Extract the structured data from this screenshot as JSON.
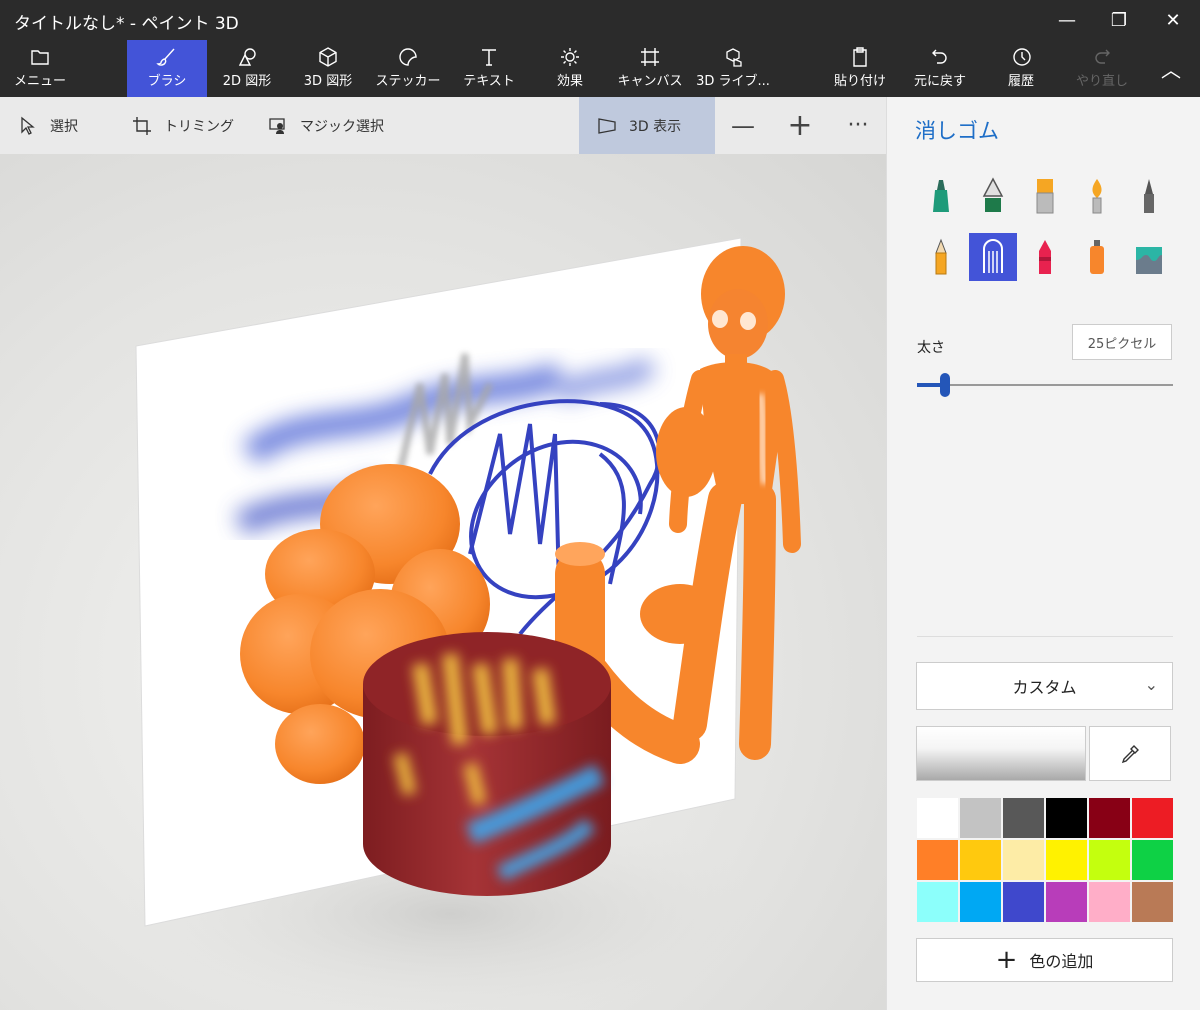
{
  "window": {
    "title": "タイトルなし* - ペイント 3D",
    "minimize_glyph": "—",
    "maximize_glyph": "❐",
    "close_glyph": "✕"
  },
  "ribbon": {
    "tabs": [
      {
        "label": "メニュー",
        "icon": "folder-icon"
      },
      {
        "label": "ブラシ",
        "icon": "brush-icon",
        "active": true
      },
      {
        "label": "2D 図形",
        "icon": "2d-shapes-icon"
      },
      {
        "label": "3D 図形",
        "icon": "3d-shapes-icon"
      },
      {
        "label": "ステッカー",
        "icon": "sticker-icon"
      },
      {
        "label": "テキスト",
        "icon": "text-icon"
      },
      {
        "label": "効果",
        "icon": "effects-icon"
      },
      {
        "label": "キャンバス",
        "icon": "canvas-icon"
      },
      {
        "label": "3D ライブ...",
        "icon": "3d-library-icon"
      },
      {
        "label": "貼り付け",
        "icon": "paste-icon"
      },
      {
        "label": "元に戻す",
        "icon": "undo-icon"
      },
      {
        "label": "履歴",
        "icon": "history-icon"
      },
      {
        "label": "やり直し",
        "icon": "redo-icon",
        "disabled": true
      }
    ],
    "collapse_glyph": "︿"
  },
  "toolbar": {
    "select": "選択",
    "crop": "トリミング",
    "magic_select": "マジック選択",
    "view3d": "3D 表示",
    "zoom_out": "—",
    "zoom_in": "+",
    "more": "···"
  },
  "panel": {
    "title": "消しゴム",
    "tools": [
      "marker-icon",
      "calligraphy-pen-icon",
      "oil-brush-icon",
      "watercolor-icon",
      "pixel-pen-icon",
      "pencil-icon",
      "eraser-icon",
      "crayon-icon",
      "spray-can-icon",
      "fill-icon"
    ],
    "selected_tool": "eraser-icon",
    "thickness_label": "太さ",
    "thickness_value": "25ピクセル",
    "thickness_fraction": 0.11,
    "color_mode": "カスタム",
    "palette": [
      "#ffffff",
      "#c3c3c3",
      "#585858",
      "#000000",
      "#880015",
      "#ed1c24",
      "#ff7f27",
      "#ffc90e",
      "#fdeca6",
      "#fff200",
      "#c4ff0e",
      "#0ed145",
      "#8cfffb",
      "#00a8f3",
      "#3f48cc",
      "#b83dba",
      "#ffaec8",
      "#b97a56"
    ],
    "add_color": "色の追加"
  }
}
